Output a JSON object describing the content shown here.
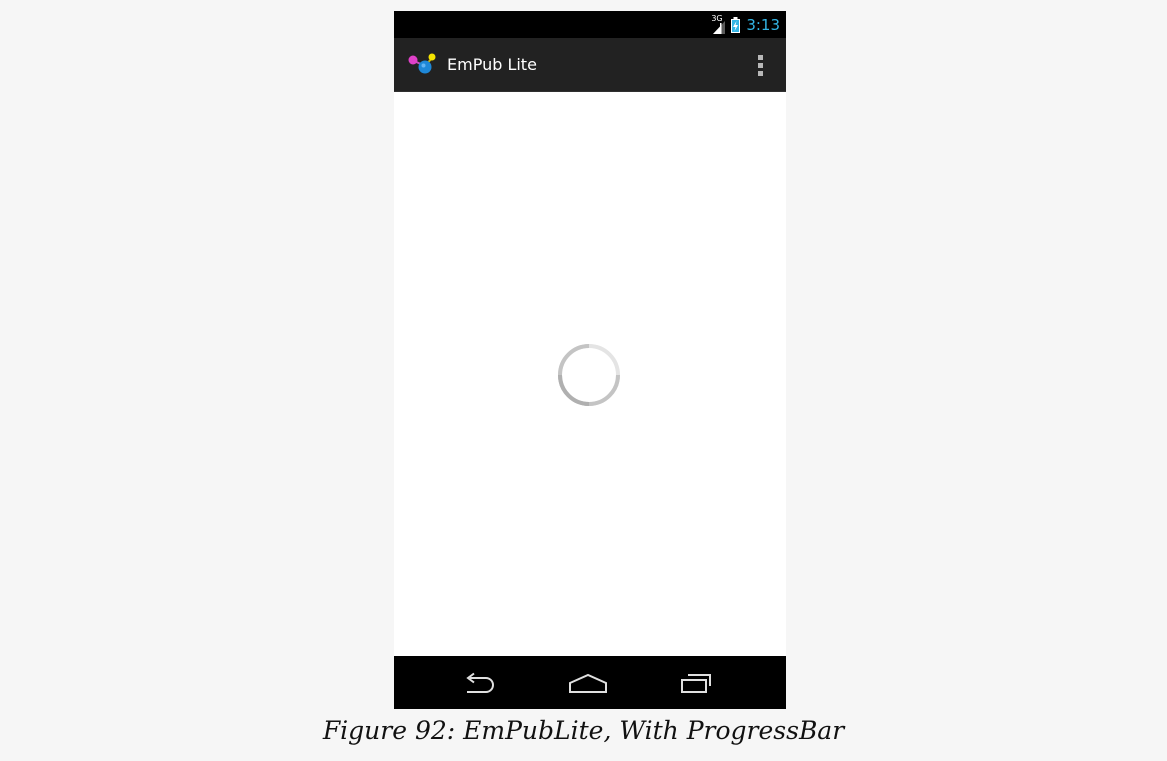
{
  "status_bar": {
    "network_type": "3G",
    "time": "3:13",
    "signal_icon": "signal-icon",
    "battery_icon": "battery-charging-icon",
    "time_color": "#33b5e5"
  },
  "action_bar": {
    "app_icon": "empub-logo-icon",
    "title": "EmPub Lite",
    "overflow_icon": "overflow-menu-icon",
    "background": "#222222"
  },
  "content": {
    "spinner_icon": "progress-spinner-icon",
    "background": "#ffffff"
  },
  "nav_bar": {
    "back_icon": "back-icon",
    "home_icon": "home-icon",
    "recents_icon": "recent-apps-icon"
  },
  "caption": "Figure 92: EmPubLite, With ProgressBar"
}
